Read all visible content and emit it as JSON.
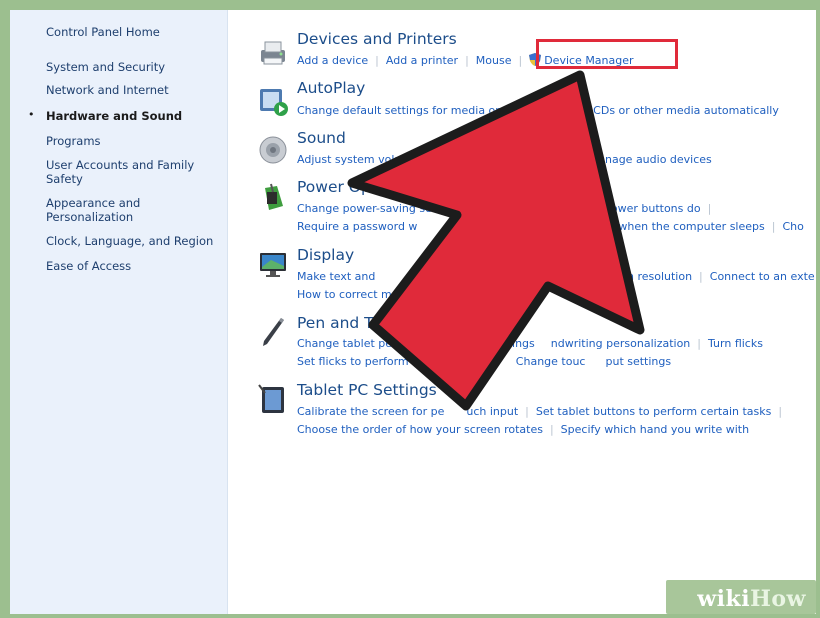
{
  "colors": {
    "accent_red": "#e02a3a",
    "link_blue": "#1f5fbf",
    "title_blue": "#1c4d8a",
    "sidebar_bg": "#eaf1fb"
  },
  "sidebar": {
    "items": [
      {
        "label": "Control Panel Home"
      },
      {
        "label": "System and Security"
      },
      {
        "label": "Network and Internet"
      },
      {
        "label": "Hardware and Sound",
        "current": true
      },
      {
        "label": "Programs"
      },
      {
        "label": "User Accounts and Family Safety"
      },
      {
        "label": "Appearance and Personalization"
      },
      {
        "label": "Clock, Language, and Region"
      },
      {
        "label": "Ease of Access"
      }
    ]
  },
  "categories": [
    {
      "title": "Devices and Printers",
      "icon": "printer-icon",
      "rows": [
        [
          "Add a device",
          "Add a printer",
          "Mouse",
          "Device Manager"
        ]
      ]
    },
    {
      "title": "AutoPlay",
      "icon": "autoplay-icon",
      "rows": [
        [
          "Change default settings for media or devices",
          "CDs or other media automatically"
        ]
      ]
    },
    {
      "title": "Sound",
      "icon": "speaker-icon",
      "rows": [
        [
          "Adjust system volume",
          "Change",
          "Manage audio devices"
        ]
      ]
    },
    {
      "title": "Power Options",
      "icon": "power-icon",
      "rows": [
        [
          "Change power-saving se",
          "power buttons do"
        ],
        [
          "Require a password w",
          "ange when the computer sleeps",
          "Cho"
        ]
      ]
    },
    {
      "title": "Display",
      "icon": "monitor-icon",
      "rows": [
        [
          "Make text and",
          "screen resolution",
          "Connect to an exte"
        ],
        [
          "How to correct monitor flicke"
        ]
      ]
    },
    {
      "title": "Pen and Touch",
      "icon": "pen-icon",
      "rows": [
        [
          "Change tablet pen setting",
          "e settings",
          "ndwriting personalization",
          "Turn flicks"
        ],
        [
          "Set flicks to perform cert",
          "Change touc",
          "put settings"
        ]
      ]
    },
    {
      "title": "Tablet PC Settings",
      "icon": "tablet-icon",
      "rows": [
        [
          "Calibrate the screen for pe",
          "uch input",
          "Set tablet buttons to perform certain tasks"
        ],
        [
          "Choose the order of how your screen rotates",
          "Specify which hand you write with"
        ]
      ]
    }
  ],
  "watermark": {
    "part1": "wiki",
    "part2": "How"
  }
}
